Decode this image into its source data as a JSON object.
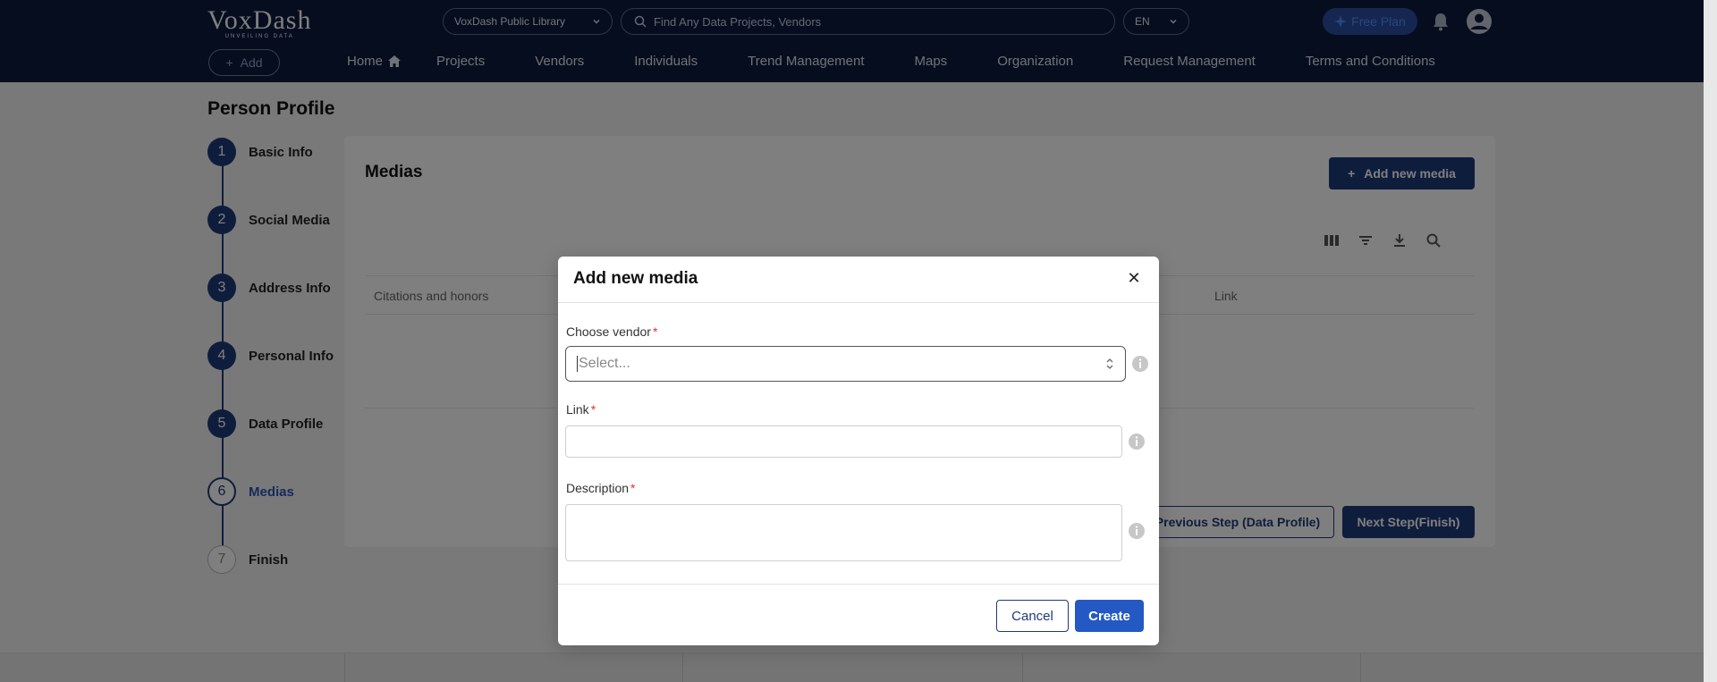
{
  "header": {
    "logo": "VoxDash",
    "logo_tagline": "UNVEILING DATA",
    "library_select": "VoxDash Public Library",
    "search_placeholder": "Find Any Data Projects, Vendors",
    "language": "EN",
    "free_plan": "Free Plan",
    "add_label": "Add",
    "nav": [
      "Home",
      "Projects",
      "Vendors",
      "Individuals",
      "Trend Management",
      "Maps",
      "Organization",
      "Request Management",
      "Terms and Conditions"
    ]
  },
  "page": {
    "title": "Person Profile",
    "steps": [
      {
        "num": "1",
        "label": "Basic Info"
      },
      {
        "num": "2",
        "label": "Social Media"
      },
      {
        "num": "3",
        "label": "Address Info"
      },
      {
        "num": "4",
        "label": "Personal Info"
      },
      {
        "num": "5",
        "label": "Data Profile"
      },
      {
        "num": "6",
        "label": "Medias"
      },
      {
        "num": "7",
        "label": "Finish"
      }
    ],
    "current_step": 6
  },
  "card": {
    "title": "Medias",
    "add_button": "Add new media",
    "columns": [
      "Citations and honors",
      "Link"
    ],
    "prev_button": "Previous Step (Data Profile)",
    "next_button": "Next Step(Finish)"
  },
  "modal": {
    "title": "Add new media",
    "vendor_label": "Choose vendor",
    "vendor_placeholder": "Select...",
    "link_label": "Link",
    "description_label": "Description",
    "required_mark": "*",
    "cancel": "Cancel",
    "create": "Create"
  },
  "colors": {
    "primary": "#1e3a7a",
    "accent": "#2459c4",
    "required": "#d33333"
  }
}
